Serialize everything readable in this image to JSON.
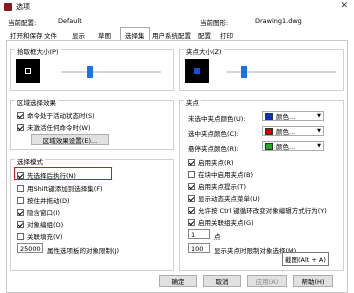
{
  "window": {
    "title": "选项"
  },
  "header": {
    "current_config_label": "当前配置:",
    "current_config_value": "Default",
    "current_drawing_label": "当前图形:",
    "current_drawing_value": "Drawing1.dwg"
  },
  "tabs": [
    {
      "label": "打开和保存"
    },
    {
      "label": "文件"
    },
    {
      "label": "显示"
    },
    {
      "label": "草图"
    },
    {
      "label": "选择集"
    },
    {
      "label": "用户系统配置"
    },
    {
      "label": "配置"
    },
    {
      "label": "打印"
    }
  ],
  "pickbox": {
    "title": "拾取框大小(P)"
  },
  "gripsize": {
    "title": "夹点大小(Z)"
  },
  "selection_preview": {
    "title": "区域选择效果",
    "opt1": "命令处于活动状态时(S)",
    "opt2": "未激活任何命令时(W)",
    "button": "区域效果设置(E)..."
  },
  "grips": {
    "title": "夹点",
    "unselected_label": "未选中夹点颜色(U):",
    "selected_label": "选中夹点颜色(C):",
    "hover_label": "悬停夹点颜色(R):",
    "color_text": "颜色...",
    "unselected_color": "#0033cc",
    "selected_color": "#cc0000",
    "hover_color": "#22aa22",
    "enable_grips": "启用夹点(R)",
    "grips_in_blocks": "在块中启用夹点(B)",
    "grip_tips": "启用夹点提示(T)",
    "dynamic_menu": "显示动态夹点菜单(U)",
    "ctrl_cycle": "允许按 Ctrl 键循环改变对象编辑方式行为(Y)",
    "group_grips": "启用关联组夹点(G)",
    "dot_value": "1",
    "dot_label": "点",
    "limit_value": "100",
    "limit_label": "显示夹点时限制对象选择(M)"
  },
  "selection_mode": {
    "title": "选择模式",
    "noun_verb": "先选择后执行(N)",
    "shift_add": "用Shift键添加到选择集(F)",
    "press_drag": "按住并拖动(D)",
    "implied_window": "隐含窗口(I)",
    "object_grouping": "对象编组(O)",
    "assoc_fill": "关联填充(V)",
    "limit_value": "25000",
    "limit_label": "属性选项板的对象限制(J)"
  },
  "tooltip": "截图(Alt + A)",
  "footer": {
    "ok": "确定",
    "cancel": "取消",
    "apply": "应用(A)",
    "help": "帮助(H)"
  }
}
